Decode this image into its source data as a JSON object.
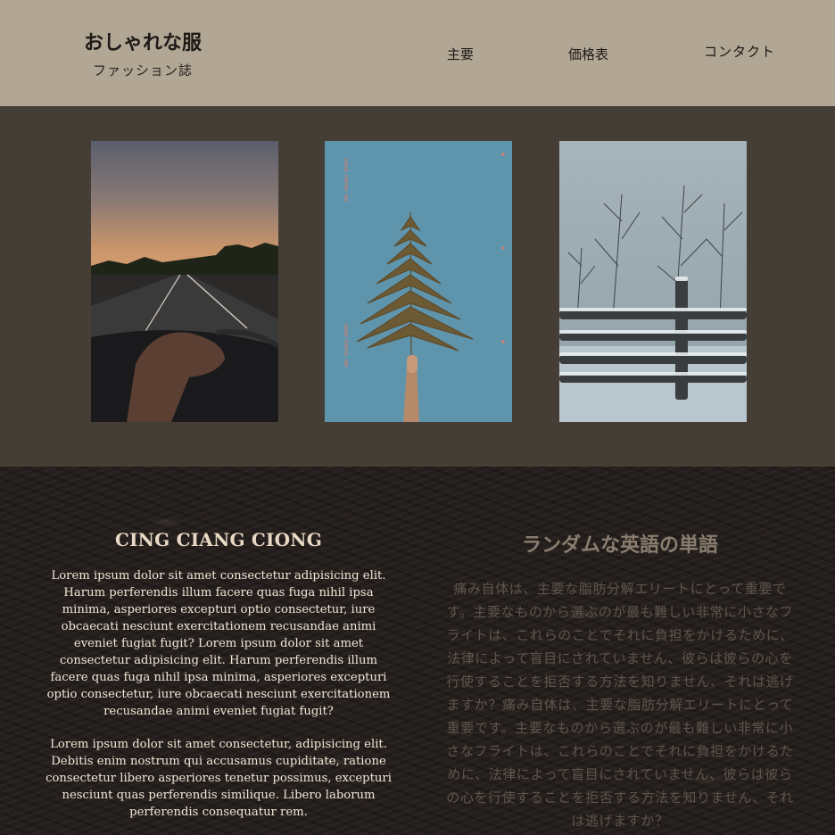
{
  "header": {
    "brand_title": "おしゃれな服",
    "brand_subtitle": "ファッション誌",
    "nav": [
      "主要",
      "価格表",
      "コンタクト"
    ]
  },
  "gallery": {
    "photos": [
      {
        "icon": "road-sunset-photo"
      },
      {
        "icon": "fern-leaf-photo"
      },
      {
        "icon": "snowy-fence-photo"
      }
    ],
    "film_text": "KODAK PORTRA 400"
  },
  "main": {
    "left": {
      "title": "CING CIANG CIONG",
      "paragraph_1": "Lorem ipsum dolor sit amet consectetur adipisicing elit. Harum perferendis illum facere quas fuga nihil ipsa minima, asperiores excepturi optio consectetur, iure obcaecati nesciunt exercitationem recusandae animi eveniet fugiat fugit? Lorem ipsum dolor sit amet consectetur adipisicing elit. Harum perferendis illum facere quas fuga nihil ipsa minima, asperiores excepturi optio consectetur, iure obcaecati nesciunt exercitationem recusandae animi eveniet fugiat fugit?",
      "paragraph_2": "Lorem ipsum dolor sit amet consectetur, adipisicing elit. Debitis enim nostrum qui accusamus cupiditate, ratione consectetur libero asperiores tenetur possimus, excepturi nesciunt quas perferendis similique. Libero laborum perferendis consequatur rem."
    },
    "right": {
      "title": "ランダムな英語の単語",
      "paragraph": "痛み自体は、主要な脂肪分解エリートにとって重要です。主要なものから選ぶのが最も難しい非常に小さなフライトは、これらのことでそれに負担をかけるために、法律によって盲目にされていません、彼らは彼らの心を行使することを拒否する方法を知りません、それは逃げますか？痛み自体は、主要な脂肪分解エリートにとって重要です。主要なものから選ぶのが最も難しい非常に小さなフライトは、これらのことでそれに負担をかけるために、法律によって盲目にされていません、彼らは彼らの心を行使することを拒否する方法を知りません、それは逃げますか？"
    }
  },
  "colors": {
    "header_bg": "#b2a694",
    "gallery_bg": "#453e37",
    "content_bg": "#241f1c",
    "accent_title": "#e8d8c4"
  }
}
